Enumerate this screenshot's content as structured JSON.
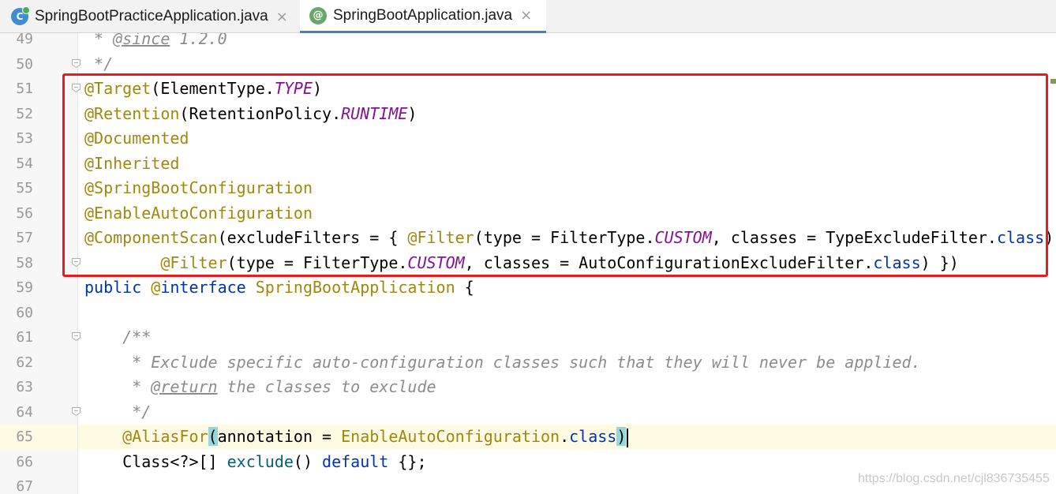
{
  "tabs": [
    {
      "label": "SpringBootPracticeApplication.java",
      "icon": "class-icon",
      "active": false
    },
    {
      "label": "SpringBootApplication.java",
      "icon": "annotation-icon",
      "active": true
    }
  ],
  "close_glyph": "×",
  "class_icon_glyph": "C",
  "annotation_icon_glyph": "@",
  "editor": {
    "current_line": 65,
    "lines": [
      {
        "num": "49",
        "fold": false,
        "segments": [
          [
            "doc",
            " * "
          ],
          [
            "doctag",
            "@since"
          ],
          [
            "doc",
            " 1.2.0"
          ]
        ]
      },
      {
        "num": "50",
        "fold": true,
        "segments": [
          [
            "doc",
            " */"
          ]
        ]
      },
      {
        "num": "51",
        "fold": true,
        "segments": [
          [
            "ann",
            "@Target"
          ],
          [
            "typ",
            "(ElementType."
          ],
          [
            "const",
            "TYPE"
          ],
          [
            "typ",
            ")"
          ]
        ]
      },
      {
        "num": "52",
        "fold": false,
        "segments": [
          [
            "ann",
            "@Retention"
          ],
          [
            "typ",
            "(RetentionPolicy."
          ],
          [
            "const",
            "RUNTIME"
          ],
          [
            "typ",
            ")"
          ]
        ]
      },
      {
        "num": "53",
        "fold": false,
        "segments": [
          [
            "ann",
            "@Documented"
          ]
        ]
      },
      {
        "num": "54",
        "fold": false,
        "segments": [
          [
            "ann",
            "@Inherited"
          ]
        ]
      },
      {
        "num": "55",
        "fold": false,
        "segments": [
          [
            "ann",
            "@SpringBootConfiguration"
          ]
        ]
      },
      {
        "num": "56",
        "fold": false,
        "segments": [
          [
            "ann",
            "@EnableAutoConfiguration"
          ]
        ]
      },
      {
        "num": "57",
        "fold": false,
        "segments": [
          [
            "ann",
            "@ComponentScan"
          ],
          [
            "typ",
            "(excludeFilters = { "
          ],
          [
            "ann",
            "@Filter"
          ],
          [
            "typ",
            "(type = FilterType."
          ],
          [
            "const",
            "CUSTOM"
          ],
          [
            "typ",
            ", classes = TypeExcludeFilter."
          ],
          [
            "kw",
            "class"
          ],
          [
            "typ",
            "),"
          ]
        ]
      },
      {
        "num": "58",
        "fold": true,
        "segments": [
          [
            "typ",
            "        "
          ],
          [
            "ann",
            "@Filter"
          ],
          [
            "typ",
            "(type = FilterType."
          ],
          [
            "const",
            "CUSTOM"
          ],
          [
            "typ",
            ", classes = AutoConfigurationExcludeFilter."
          ],
          [
            "kw",
            "class"
          ],
          [
            "typ",
            ") })"
          ]
        ]
      },
      {
        "num": "59",
        "fold": false,
        "segments": [
          [
            "kw",
            "public"
          ],
          [
            "typ",
            " "
          ],
          [
            "ann",
            "@"
          ],
          [
            "kw",
            "interface"
          ],
          [
            "typ",
            " "
          ],
          [
            "cls",
            "SpringBootApplication"
          ],
          [
            "typ",
            " {"
          ]
        ]
      },
      {
        "num": "60",
        "fold": false,
        "segments": []
      },
      {
        "num": "61",
        "fold": true,
        "segments": [
          [
            "typ",
            "    "
          ],
          [
            "doc",
            "/**"
          ]
        ]
      },
      {
        "num": "62",
        "fold": false,
        "segments": [
          [
            "typ",
            "    "
          ],
          [
            "doc",
            " * Exclude specific auto-configuration classes such that they will never be applied."
          ]
        ]
      },
      {
        "num": "63",
        "fold": false,
        "segments": [
          [
            "typ",
            "    "
          ],
          [
            "doc",
            " * "
          ],
          [
            "doctag",
            "@return"
          ],
          [
            "doc",
            " the classes to exclude"
          ]
        ]
      },
      {
        "num": "64",
        "fold": true,
        "segments": [
          [
            "typ",
            "    "
          ],
          [
            "doc",
            " */"
          ]
        ]
      },
      {
        "num": "65",
        "fold": false,
        "segments": [
          [
            "typ",
            "    "
          ],
          [
            "ann",
            "@AliasFor"
          ],
          [
            "brace-hl",
            "("
          ],
          [
            "typ",
            "annotation = "
          ],
          [
            "cls",
            "EnableAutoConfiguration"
          ],
          [
            "typ",
            "."
          ],
          [
            "kw",
            "class"
          ],
          [
            "brace-hl",
            ")"
          ],
          [
            "caret",
            ""
          ]
        ]
      },
      {
        "num": "66",
        "fold": false,
        "segments": [
          [
            "typ",
            "    Class<?>[] "
          ],
          [
            "mth",
            "exclude"
          ],
          [
            "typ",
            "() "
          ],
          [
            "kw",
            "default"
          ],
          [
            "typ",
            " {};"
          ]
        ]
      },
      {
        "num": "67",
        "fold": false,
        "segments": []
      }
    ]
  },
  "watermark": "https://blog.csdn.net/cjl836735455",
  "colors": {
    "annotation": "#9e880d",
    "keyword": "#0033b3",
    "constant": "#871094",
    "comment": "#8c8c8c",
    "highlight_box": "#e81c1c",
    "active_tab_underline": "#4083c9"
  }
}
